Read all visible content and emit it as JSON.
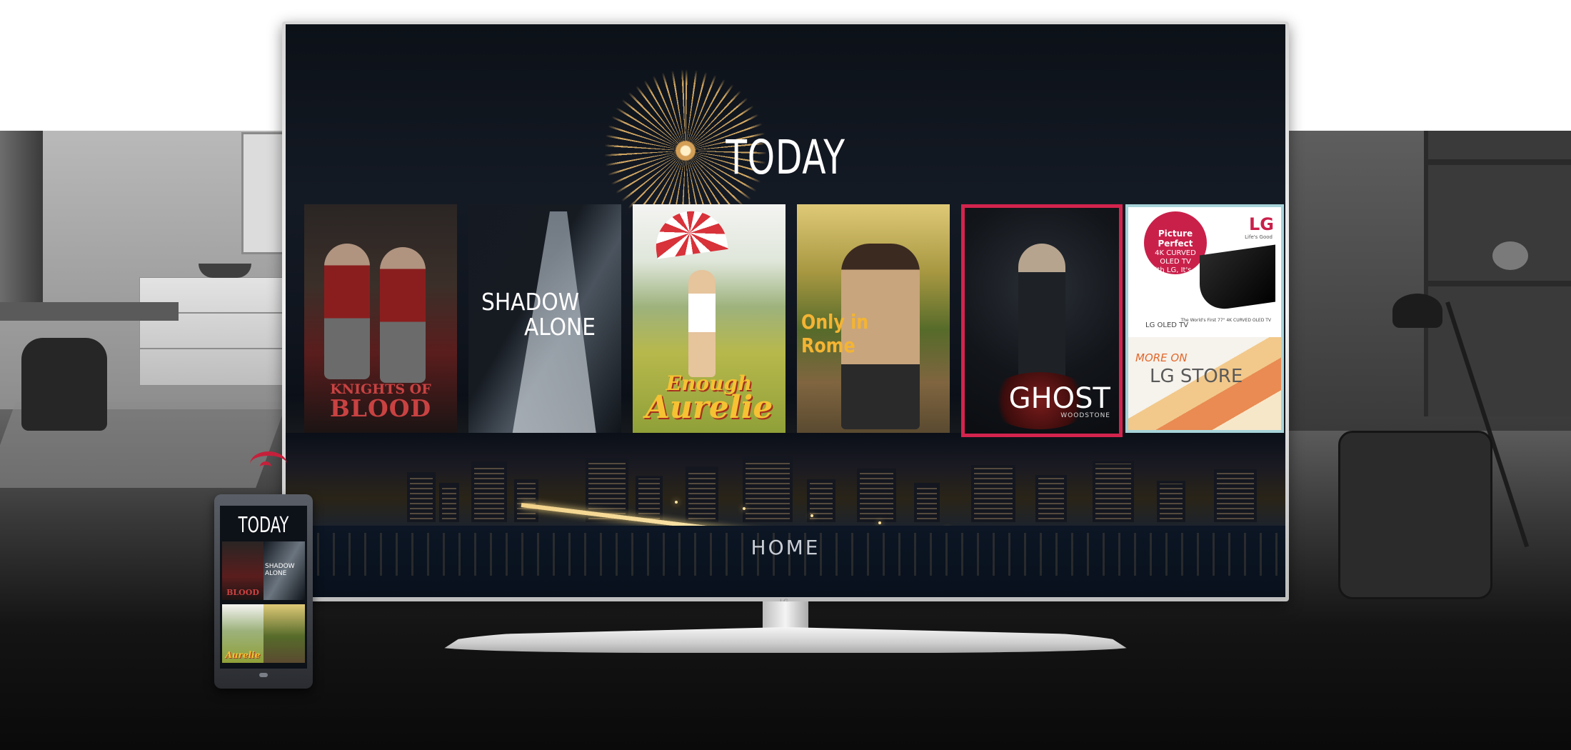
{
  "screen": {
    "title": "TODAY",
    "nav_label": "HOME"
  },
  "tiles": [
    {
      "title_line1": "KNIGHTS OF",
      "title_line2": "BLOOD"
    },
    {
      "title_line1": "SHADOW",
      "title_line2": "ALONE"
    },
    {
      "title_line1": "Enough",
      "title_line2": "Aurelie"
    },
    {
      "title_line1": "Only in Rome"
    },
    {
      "title_line1": "GHOST",
      "subtitle": "WOODSTONE",
      "selected": true
    },
    {
      "ad_circle_title": "Picture Perfect",
      "ad_circle_line2": "4K CURVED OLED TV",
      "ad_circle_line3": "With LG, It's All Possible",
      "brand": "LG",
      "brand_tagline": "Life's Good",
      "product": "LG OLED TV",
      "product_note": "The World's First 77\" 4K CURVED OLED TV",
      "store_line1": "MORE ON",
      "store_line2": "LG STORE"
    }
  ],
  "phone": {
    "title": "TODAY",
    "tiles": [
      "BLOOD",
      "SHADOW ALONE",
      "Aurelie",
      ""
    ]
  },
  "tv_brand": "LG",
  "colors": {
    "selection": "#d3244e",
    "lg_red": "#c9204a",
    "cast_icon": "#c5203b"
  }
}
